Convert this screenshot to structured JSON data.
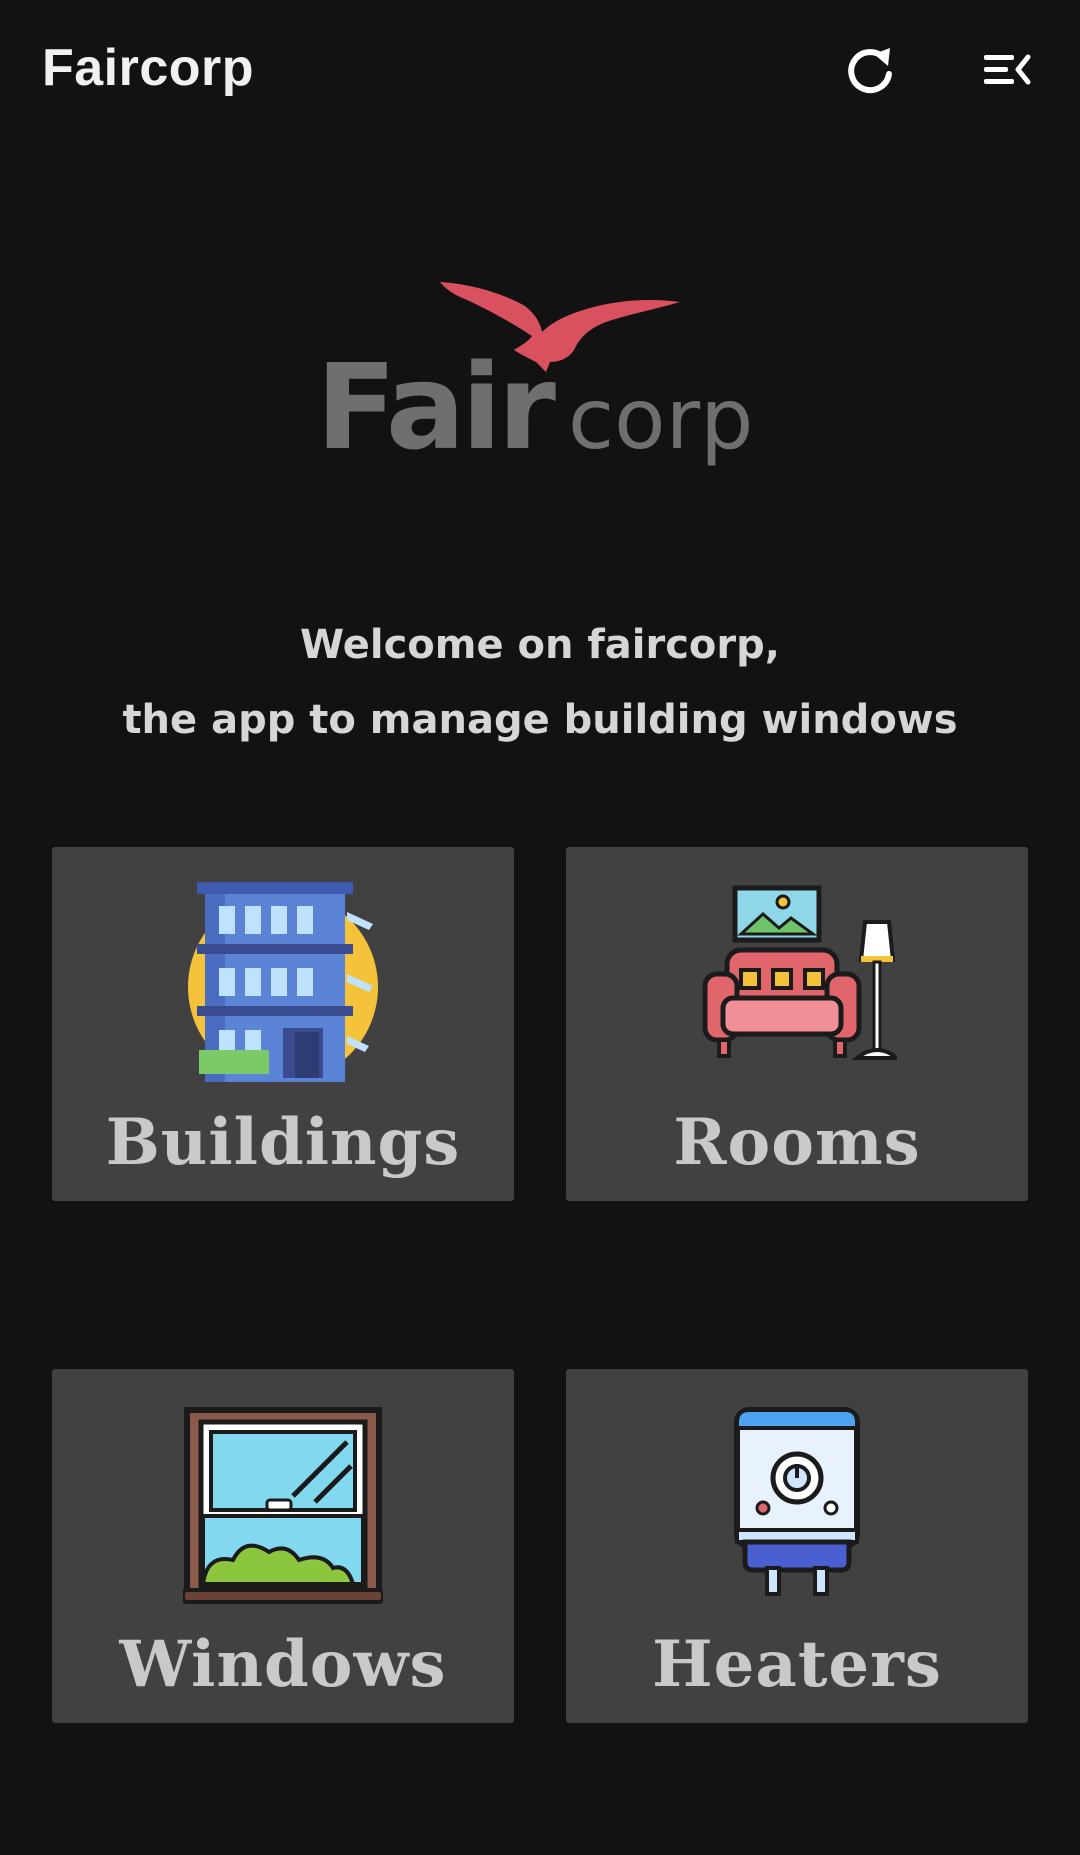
{
  "app_bar": {
    "title": "Faircorp",
    "refresh_icon": "refresh-icon",
    "menu_icon": "menu-open-icon"
  },
  "logo": {
    "text_bold": "Fair",
    "text_light": "corp",
    "bird_color": "#d9515e",
    "text_color": "#6f6f6f"
  },
  "welcome": {
    "line1": "Welcome on faircorp,",
    "line2": "the app to manage building windows"
  },
  "tiles": [
    {
      "label": "Buildings",
      "icon": "building-icon"
    },
    {
      "label": "Rooms",
      "icon": "sofa-icon"
    },
    {
      "label": "Windows",
      "icon": "window-icon"
    },
    {
      "label": "Heaters",
      "icon": "heater-icon"
    }
  ],
  "colors": {
    "background": "#121212",
    "tile": "#414141",
    "tile_text": "#c9c9c9"
  }
}
